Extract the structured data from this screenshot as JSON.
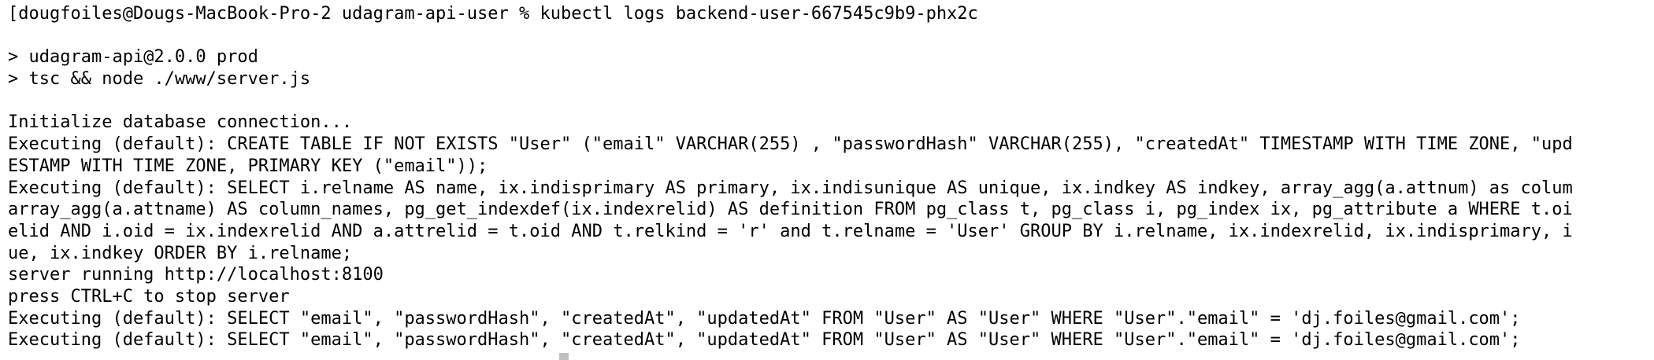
{
  "terminal": {
    "prompt_line": "[dougfoiles@Dougs-MacBook-Pro-2 udagram-api-user % kubectl logs backend-user-667545c9b9-phx2c",
    "lines": [
      "",
      "> udagram-api@2.0.0 prod",
      "> tsc && node ./www/server.js",
      "",
      "Initialize database connection...",
      "Executing (default): CREATE TABLE IF NOT EXISTS \"User\" (\"email\" VARCHAR(255) , \"passwordHash\" VARCHAR(255), \"createdAt\" TIMESTAMP WITH TIME ZONE, \"upd",
      "ESTAMP WITH TIME ZONE, PRIMARY KEY (\"email\"));",
      "Executing (default): SELECT i.relname AS name, ix.indisprimary AS primary, ix.indisunique AS unique, ix.indkey AS indkey, array_agg(a.attnum) as colum",
      "array_agg(a.attname) AS column_names, pg_get_indexdef(ix.indexrelid) AS definition FROM pg_class t, pg_class i, pg_index ix, pg_attribute a WHERE t.oi",
      "elid AND i.oid = ix.indexrelid AND a.attrelid = t.oid AND t.relkind = 'r' and t.relname = 'User' GROUP BY i.relname, ix.indexrelid, ix.indisprimary, i",
      "ue, ix.indkey ORDER BY i.relname;",
      "server running http://localhost:8100",
      "press CTRL+C to stop server",
      "Executing (default): SELECT \"email\", \"passwordHash\", \"createdAt\", \"updatedAt\" FROM \"User\" AS \"User\" WHERE \"User\".\"email\" = 'dj.foiles@gmail.com';",
      "Executing (default): SELECT \"email\", \"passwordHash\", \"createdAt\", \"updatedAt\" FROM \"User\" AS \"User\" WHERE \"User\".\"email\" = 'dj.foiles@gmail.com';"
    ]
  }
}
